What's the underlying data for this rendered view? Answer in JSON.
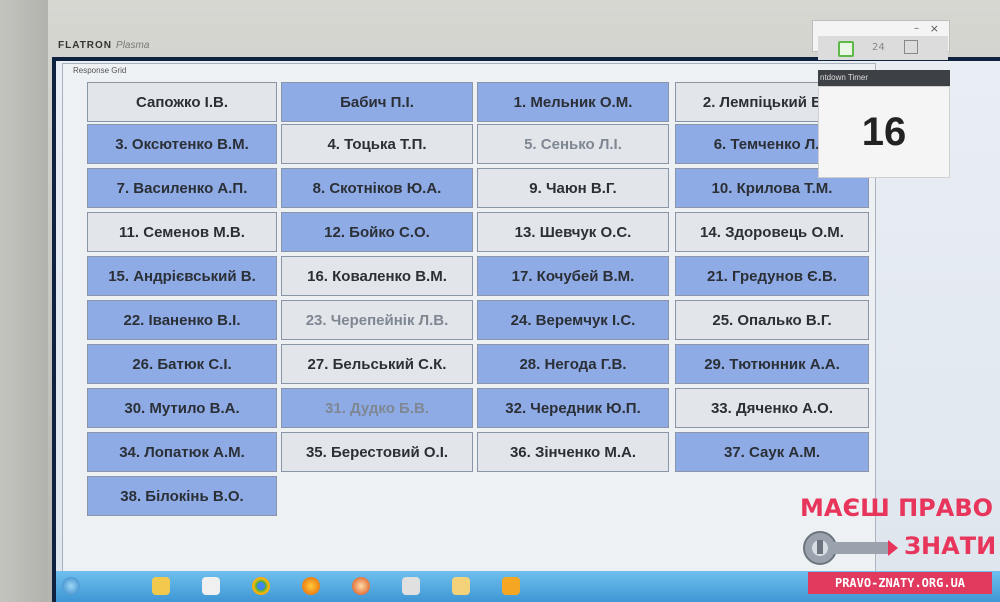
{
  "monitor": {
    "brand": "FLATRON",
    "brand_sub": "Plasma"
  },
  "window": {
    "title": "Response Grid"
  },
  "timer": {
    "header": "ntdown Timer",
    "value": "16",
    "toolbar_number": "24"
  },
  "grid": {
    "cells": [
      {
        "label": "Сапожко І.В.",
        "state": "gray"
      },
      {
        "label": "Бабич П.І.",
        "state": "blue"
      },
      {
        "label": "1. Мельник О.М.",
        "state": "blue"
      },
      {
        "label": "2. Лемпіцький В.А.",
        "state": "gray"
      },
      {
        "label": "3. Оксютенко В.М.",
        "state": "blue"
      },
      {
        "label": "4. Тоцька Т.П.",
        "state": "gray"
      },
      {
        "label": "5. Сенько Л.І.",
        "state": "gray-faint"
      },
      {
        "label": "6. Темченко Л.Г.",
        "state": "blue"
      },
      {
        "label": "7. Василенко А.П.",
        "state": "blue"
      },
      {
        "label": "8. Скотніков Ю.А.",
        "state": "blue"
      },
      {
        "label": "9. Чаюн В.Г.",
        "state": "gray"
      },
      {
        "label": "10. Крилова Т.М.",
        "state": "blue"
      },
      {
        "label": "11. Семенов М.В.",
        "state": "gray"
      },
      {
        "label": "12. Бойко С.О.",
        "state": "blue"
      },
      {
        "label": "13. Шевчук О.С.",
        "state": "gray"
      },
      {
        "label": "14. Здоровець О.М.",
        "state": "gray"
      },
      {
        "label": "15. Андрієвський В.",
        "state": "blue"
      },
      {
        "label": "16. Коваленко В.М.",
        "state": "gray"
      },
      {
        "label": "17. Кочубей В.М.",
        "state": "blue"
      },
      {
        "label": "21. Гредунов Є.В.",
        "state": "blue"
      },
      {
        "label": "22. Іваненко В.І.",
        "state": "blue"
      },
      {
        "label": "23. Черепейнік Л.В.",
        "state": "gray-faint"
      },
      {
        "label": "24. Веремчук І.С.",
        "state": "blue"
      },
      {
        "label": "25. Опалько В.Г.",
        "state": "gray"
      },
      {
        "label": "26. Батюк С.І.",
        "state": "blue"
      },
      {
        "label": "27. Бельський С.К.",
        "state": "gray"
      },
      {
        "label": "28. Негода Г.В.",
        "state": "blue"
      },
      {
        "label": "29. Тютюнник А.А.",
        "state": "blue"
      },
      {
        "label": "30. Мутило В.А.",
        "state": "blue"
      },
      {
        "label": "31. Дудко Б.В.",
        "state": "blue-faint"
      },
      {
        "label": "32. Чередник Ю.П.",
        "state": "blue"
      },
      {
        "label": "33. Дяченко А.О.",
        "state": "gray"
      },
      {
        "label": "34. Лопатюк А.М.",
        "state": "blue"
      },
      {
        "label": "35. Берестовий О.І.",
        "state": "gray"
      },
      {
        "label": "36. Зінченко М.А.",
        "state": "gray"
      },
      {
        "label": "37. Саук А.М.",
        "state": "blue"
      },
      {
        "label": "38. Білокінь В.О.",
        "state": "blue"
      }
    ]
  },
  "watermark": {
    "line1": "МАЄШ ПРАВО",
    "line2": "ЗНАТИ",
    "url": "PRAVO-ZNATY.ORG.UA"
  }
}
